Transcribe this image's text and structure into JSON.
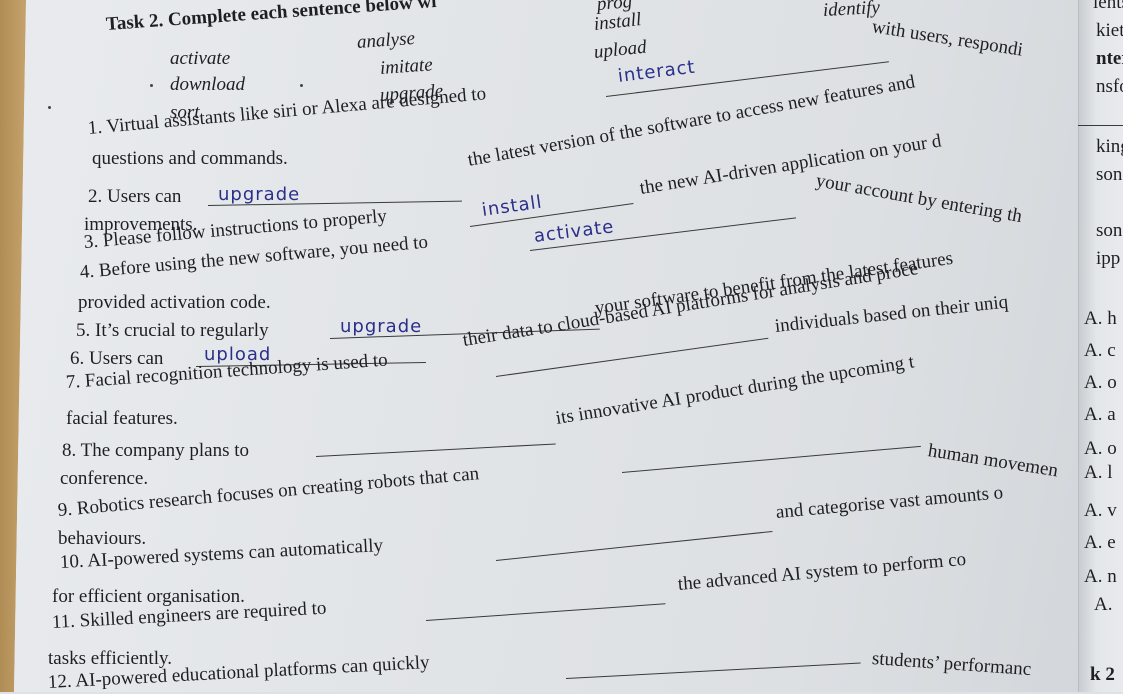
{
  "task": {
    "title": "Task 2. Complete each sentence below wi",
    "word_bank": [
      "activate",
      "download",
      "sort",
      "analyse",
      "imitate",
      "upgrade",
      "prog",
      "install",
      "upload",
      "identify"
    ]
  },
  "sentences": [
    {
      "number": "1.",
      "start": "Virtual assistants like siri or Alexa are designed to",
      "answer": "interact",
      "end": "with users, respondi",
      "cont": "questions and commands."
    },
    {
      "number": "2.",
      "start": "Users can",
      "answer": "upgrade",
      "end": "the latest version of the software to access new features and",
      "cont": "improvements."
    },
    {
      "number": "3.",
      "start": "Please follow instructions to properly",
      "answer": "install",
      "end": "the new AI-driven application on your d"
    },
    {
      "number": "4.",
      "start": "Before using the new software, you need to",
      "answer": "activate",
      "end": "your account by entering th",
      "cont": "provided activation code."
    },
    {
      "number": "5.",
      "start": "It’s crucial to regularly",
      "answer": "upgrade",
      "end": "your software to benefit from the latest features"
    },
    {
      "number": "6.",
      "start": "Users can",
      "answer": "upload",
      "end": "their data to cloud-based AI platforms for analysis and proce"
    },
    {
      "number": "7.",
      "start": "Facial recognition technology is used to",
      "answer": "",
      "end": "individuals based on their uniq",
      "cont": "facial features."
    },
    {
      "number": "8.",
      "start": "The company plans to",
      "answer": "",
      "end": "its innovative AI product during the upcoming t",
      "cont": "conference."
    },
    {
      "number": "9.",
      "start": "Robotics research focuses on creating robots that can",
      "answer": "",
      "end": "human movemen",
      "cont": "behaviours."
    },
    {
      "number": "10.",
      "start": "AI-powered systems can automatically",
      "answer": "",
      "end": "and categorise vast amounts o",
      "cont": "for efficient organisation."
    },
    {
      "number": "11.",
      "start": "Skilled engineers are required to",
      "answer": "",
      "end": "the advanced AI system to perform co",
      "cont": "tasks efficiently."
    },
    {
      "number": "12.",
      "start": "AI-powered educational platforms can quickly",
      "answer": "",
      "end": "students’ performanc"
    }
  ],
  "next_page_fragments": [
    "ients",
    "kiety",
    "nter",
    "nsfor",
    "king",
    "son.",
    "sona",
    "ipp",
    "A. h",
    "A. c",
    "A. o",
    "A. a",
    "A. o",
    "A. l",
    "A. v",
    "A. e",
    "A. n",
    "A.",
    "k 2"
  ]
}
